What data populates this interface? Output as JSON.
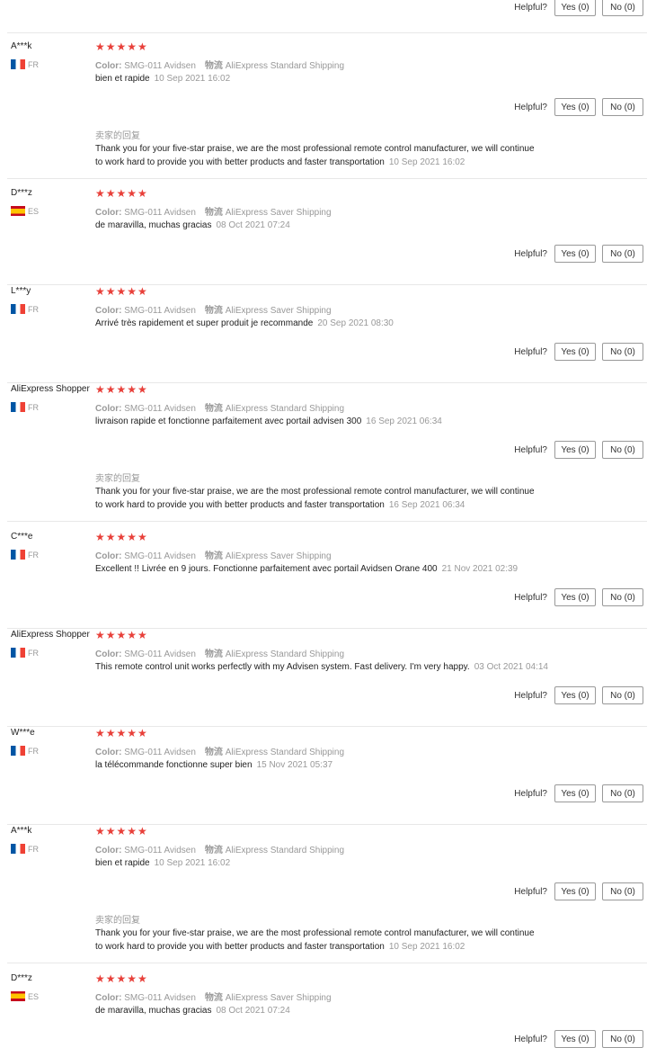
{
  "labels": {
    "helpful": "Helpful?",
    "yes": "Yes (0)",
    "no": "No (0)",
    "color_key": "Color:",
    "logistics_key": "物流",
    "seller_reply_title": "卖家的回复",
    "stars": "★★★★★"
  },
  "reviews": [
    {
      "name": "A***k",
      "country": "FR",
      "color_value": "SMG-011 Avidsen",
      "shipping": "AliExpress Standard Shipping",
      "text": "bien et rapide",
      "date": "10 Sep 2021 16:02",
      "reply": {
        "line1": "Thank you for your five-star praise, we are the most professional remote control manufacturer, we will continue",
        "line2": "to work hard to provide you with better products and faster transportation",
        "date": "10 Sep 2021 16:02"
      }
    },
    {
      "name": "D***z",
      "country": "ES",
      "color_value": "SMG-011 Avidsen",
      "shipping": "AliExpress Saver Shipping",
      "text": "de maravilla, muchas gracias",
      "date": "08 Oct 2021 07:24"
    },
    {
      "name": "L***y",
      "country": "FR",
      "color_value": "SMG-011 Avidsen",
      "shipping": "AliExpress Saver Shipping",
      "text": "Arrivé très rapidement et super produit je recommande",
      "date": "20 Sep 2021 08:30"
    },
    {
      "name": "AliExpress Shopper",
      "country": "FR",
      "color_value": "SMG-011 Avidsen",
      "shipping": "AliExpress Standard Shipping",
      "text": "livraison rapide et fonctionne parfaitement avec portail advisen 300",
      "date": "16 Sep 2021 06:34",
      "reply": {
        "line1": "Thank you for your five-star praise, we are the most professional remote control manufacturer, we will continue",
        "line2": "to work hard to provide you with better products and faster transportation",
        "date": "16 Sep 2021 06:34"
      }
    },
    {
      "name": "C***e",
      "country": "FR",
      "color_value": "SMG-011 Avidsen",
      "shipping": "AliExpress Saver Shipping",
      "text": "Excellent !! Livrée en 9 jours. Fonctionne parfaitement avec portail Avidsen Orane 400",
      "date": "21 Nov 2021 02:39"
    },
    {
      "name": "AliExpress Shopper",
      "country": "FR",
      "color_value": "SMG-011 Avidsen",
      "shipping": "AliExpress Standard Shipping",
      "text": "This remote control unit works perfectly with my Advisen system. Fast delivery. I'm very happy.",
      "date": "03 Oct 2021 04:14"
    },
    {
      "name": "W***e",
      "country": "FR",
      "color_value": "SMG-011 Avidsen",
      "shipping": "AliExpress Standard Shipping",
      "text": "la télécommande fonctionne super bien",
      "date": "15 Nov 2021 05:37"
    },
    {
      "name": "A***k",
      "country": "FR",
      "color_value": "SMG-011 Avidsen",
      "shipping": "AliExpress Standard Shipping",
      "text": "bien et rapide",
      "date": "10 Sep 2021 16:02",
      "reply": {
        "line1": "Thank you for your five-star praise, we are the most professional remote control manufacturer, we will continue",
        "line2": "to work hard to provide you with better products and faster transportation",
        "date": "10 Sep 2021 16:02"
      }
    },
    {
      "name": "D***z",
      "country": "ES",
      "color_value": "SMG-011 Avidsen",
      "shipping": "AliExpress Saver Shipping",
      "text": "de maravilla, muchas gracias",
      "date": "08 Oct 2021 07:24"
    }
  ]
}
